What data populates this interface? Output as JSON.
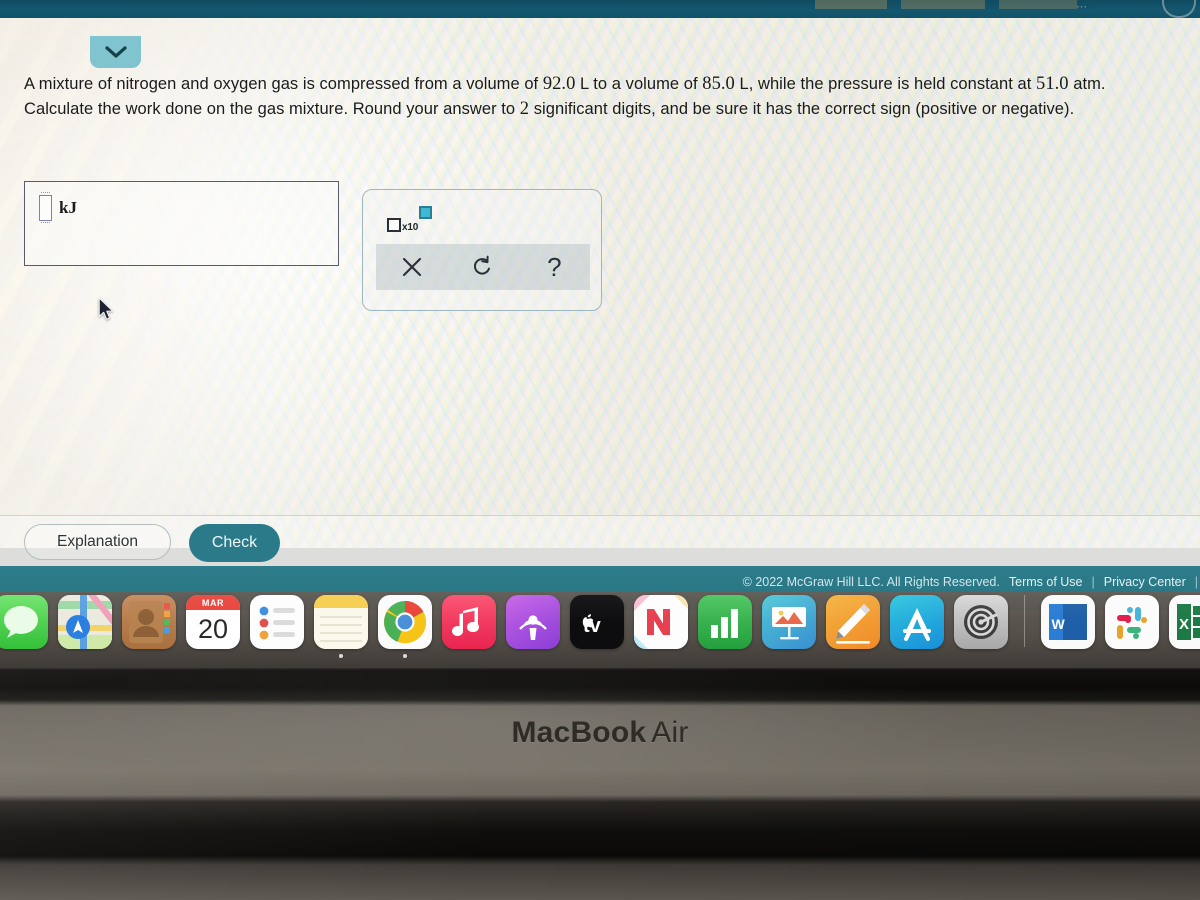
{
  "question": {
    "line1_a": "A mixture of nitrogen and oxygen gas is compressed from a volume of ",
    "v1": "92.0",
    "line1_b": " L to a volume of ",
    "v2": "85.0",
    "line1_c": " L, while the pressure is held",
    "line2_a": "constant at ",
    "p1": "51.0",
    "line2_b": " atm. Calculate the work done on the gas mixture. Round your answer to ",
    "sig": "2",
    "line2_c": " significant digits, and be sure it has the",
    "line3": "correct sign (positive or negative)."
  },
  "answer": {
    "value": "",
    "placeholder": "",
    "unit": "kJ"
  },
  "palette": {
    "sci_notation_label": "x10",
    "clear_label": "×",
    "undo_label": "↺",
    "help_label": "?"
  },
  "actions": {
    "explanation_label": "Explanation",
    "check_label": "Check"
  },
  "footer": {
    "copyright": "© 2022 McGraw Hill LLC. All Rights Reserved.",
    "terms_label": "Terms of Use",
    "separator": "|",
    "privacy_label": "Privacy Center",
    "separator2": "|"
  },
  "laptop": {
    "brand": "MacBook",
    "model": "Air"
  },
  "colors": {
    "footer_teal": "#2b7886",
    "check_button": "#2b7a8a",
    "page_tab": "#7fc4cf",
    "exponent_box": "#3fb8d4",
    "top_chrome": "#14576f"
  },
  "dock": {
    "calendar_month": "MAR",
    "calendar_day": "20",
    "items": [
      {
        "name": "messages",
        "label": "Messages",
        "running": false
      },
      {
        "name": "maps",
        "label": "Maps",
        "running": false
      },
      {
        "name": "contacts",
        "label": "Contacts",
        "running": false
      },
      {
        "name": "calendar",
        "label": "Calendar",
        "running": false
      },
      {
        "name": "reminders",
        "label": "Reminders",
        "running": false
      },
      {
        "name": "notes",
        "label": "Notes",
        "running": true
      },
      {
        "name": "chrome",
        "label": "Google Chrome",
        "running": true
      },
      {
        "name": "music",
        "label": "Music",
        "running": false
      },
      {
        "name": "podcasts",
        "label": "Podcasts",
        "running": false
      },
      {
        "name": "apple-tv",
        "label": "TV",
        "running": false
      },
      {
        "name": "news",
        "label": "News",
        "running": false
      },
      {
        "name": "numbers",
        "label": "Numbers",
        "running": false
      },
      {
        "name": "keynote",
        "label": "Keynote",
        "running": false
      },
      {
        "name": "pages",
        "label": "Pages",
        "running": false
      },
      {
        "name": "app-store",
        "label": "App Store",
        "running": false
      },
      {
        "name": "system-preferences",
        "label": "System Preferences",
        "running": false
      },
      {
        "name": "word",
        "label": "Microsoft Word",
        "running": false,
        "glyph": "W"
      },
      {
        "name": "slack",
        "label": "Slack",
        "running": false
      },
      {
        "name": "excel",
        "label": "Microsoft Excel",
        "running": false,
        "glyph": "X"
      }
    ]
  }
}
